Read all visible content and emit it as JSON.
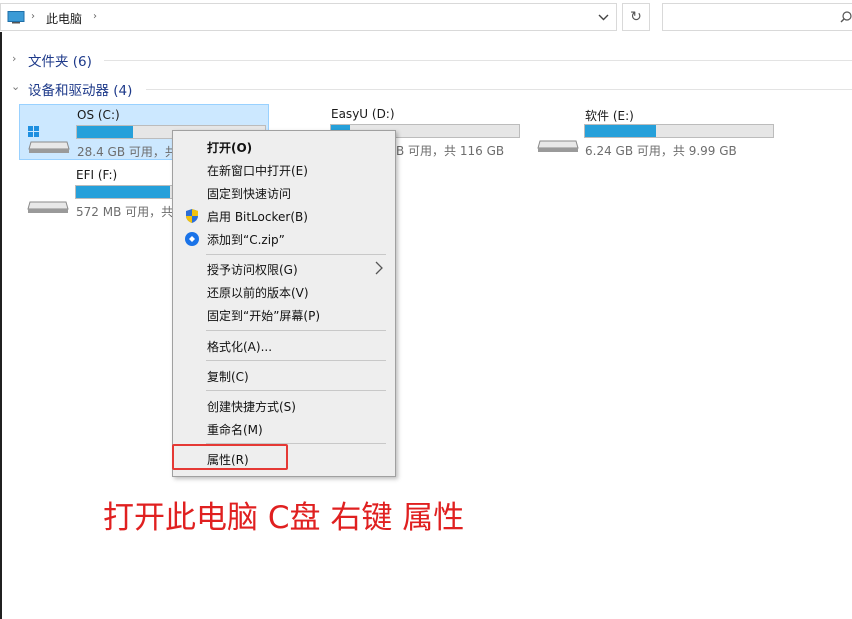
{
  "address": {
    "breadcrumb": "此电脑",
    "sep1": "›",
    "sep2": "›",
    "dropdown_icon": "chevron-down-icon",
    "refresh_icon": "refresh-icon",
    "refresh_glyph": "↻"
  },
  "groups": {
    "folders": {
      "label": "文件夹 (6)",
      "chevron": "›"
    },
    "drives": {
      "label": "设备和驱动器 (4)",
      "chevron": "⌄"
    }
  },
  "drives": [
    {
      "name": "OS (C:)",
      "space": "28.4 GB 可用，共",
      "used_fraction": 0.3,
      "selected": true
    },
    {
      "name": "EasyU (D:)",
      "space": "B 可用，共 116 GB",
      "used_fraction": 0.1
    },
    {
      "name": "软件 (E:)",
      "space": "6.24 GB 可用，共 9.99 GB",
      "used_fraction": 0.38
    },
    {
      "name": "EFI (F:)",
      "space": "572 MB 可用，共",
      "used_fraction": 0.5
    }
  ],
  "context_menu": {
    "items": [
      {
        "label": "打开(O)"
      },
      {
        "label": "在新窗口中打开(E)"
      },
      {
        "label": "固定到快速访问"
      },
      {
        "label": "启用 BitLocker(B)"
      },
      {
        "label": "添加到“C.zip”"
      },
      {
        "label": "授予访问权限(G)"
      },
      {
        "label": "还原以前的版本(V)"
      },
      {
        "label": "固定到“开始”屏幕(P)"
      },
      {
        "label": "格式化(A)..."
      },
      {
        "label": "复制(C)"
      },
      {
        "label": "创建快捷方式(S)"
      },
      {
        "label": "重命名(M)"
      },
      {
        "label": "属性(R)"
      }
    ]
  },
  "annotation": "打开此电脑 C盘 右键 属性",
  "colors": {
    "accent": "#26a0da",
    "selection": "#cce8ff",
    "highlight": "#e53935",
    "annotation": "#e02020"
  }
}
